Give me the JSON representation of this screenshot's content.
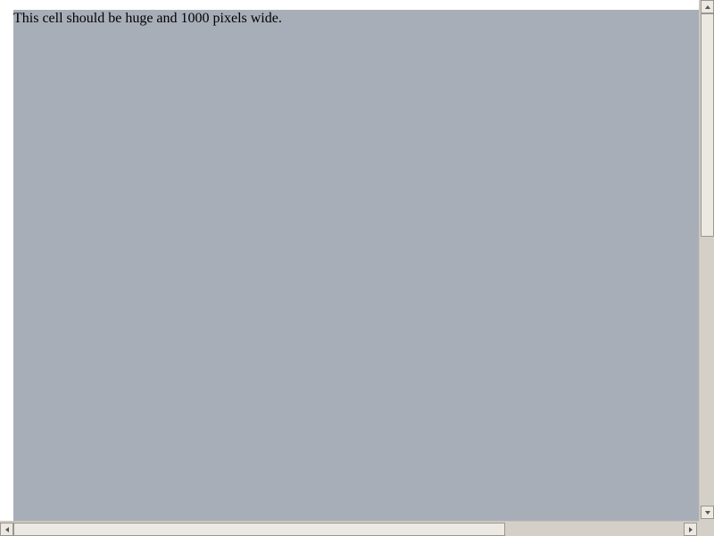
{
  "page": {
    "cell_text": "This cell should be huge and 1000 pixels wide.",
    "cell_background": "#a8aeb8"
  },
  "scrollbars": {
    "vertical": {
      "up_icon": "arrow-up-icon",
      "down_icon": "arrow-down-icon"
    },
    "horizontal": {
      "left_icon": "arrow-left-icon",
      "right_icon": "arrow-right-icon"
    }
  }
}
